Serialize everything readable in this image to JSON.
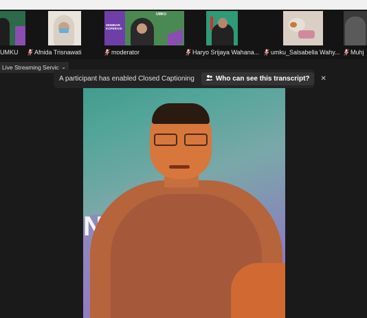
{
  "participants": [
    {
      "name": "UMKU",
      "muted": true
    },
    {
      "name": "Afnida Trisnawati",
      "muted": true
    },
    {
      "name": "moderator",
      "muted": true
    },
    {
      "name": "Haryo Srijaya Wahana...",
      "muted": true
    },
    {
      "name": "umku_Salsabella Wahy...",
      "muted": true
    },
    {
      "name": "Muhj",
      "muted": true
    }
  ],
  "slide_thumb": {
    "lines": [
      "SEMINAR",
      "KOPERASI"
    ],
    "logo_text": "UMKU"
  },
  "view_selector": {
    "label": "Live Streaming Servic",
    "chevron": "chevron-down-icon"
  },
  "caption_banner": {
    "message": "A participant has enabled Closed Captioning",
    "button_label": "Who can see this transcript?",
    "button_icon": "people-icon",
    "close_label": "✕"
  },
  "main_video": {
    "speaker": "main speaker",
    "background_colors": [
      "#3e9a8a",
      "#9b73c6"
    ],
    "overlay_letter": "N"
  },
  "colors": {
    "muted_red": "#e03a3a",
    "banner_bg": "#242424",
    "strip_bg": "#141414"
  }
}
